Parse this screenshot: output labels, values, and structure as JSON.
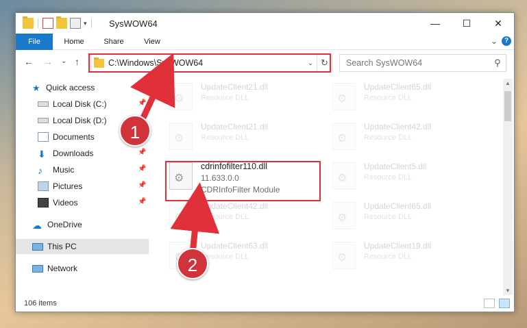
{
  "window": {
    "title": "SysWOW64",
    "controls": {
      "minimize": "—",
      "maximize": "☐",
      "close": "✕"
    }
  },
  "ribbon": {
    "tabs": [
      "File",
      "Home",
      "Share",
      "View"
    ],
    "expand_glyph": "⌄",
    "help_glyph": "?"
  },
  "nav": {
    "back": "←",
    "forward": "→",
    "recent": "⌄",
    "up": "↑",
    "address": "C:\\Windows\\SysWOW64",
    "address_dropdown": "⌄",
    "refresh": "↻",
    "search_placeholder": "Search SysWOW64",
    "search_icon": "⚲"
  },
  "sidebar": {
    "items": [
      {
        "label": "Quick access",
        "icon": "star-icon",
        "pinned": false
      },
      {
        "label": "Local Disk (C:)",
        "icon": "drive-icon",
        "pinned": true
      },
      {
        "label": "Local Disk (D:)",
        "icon": "drive-icon",
        "pinned": true
      },
      {
        "label": "Documents",
        "icon": "documents-icon",
        "pinned": true
      },
      {
        "label": "Downloads",
        "icon": "download-icon",
        "pinned": true
      },
      {
        "label": "Music",
        "icon": "music-icon",
        "pinned": true
      },
      {
        "label": "Pictures",
        "icon": "pictures-icon",
        "pinned": true
      },
      {
        "label": "Videos",
        "icon": "videos-icon",
        "pinned": true
      },
      {
        "label": "OneDrive",
        "icon": "cloud-icon",
        "pinned": false
      },
      {
        "label": "This PC",
        "icon": "computer-icon",
        "pinned": false
      },
      {
        "label": "Network",
        "icon": "network-icon",
        "pinned": false
      }
    ],
    "pin_glyph": "📌"
  },
  "files": [
    {
      "name": "UpdateClient21.dll",
      "desc": "Resource DLL"
    },
    {
      "name": "UpdateClient65.dll",
      "desc": "Resource DLL"
    },
    {
      "name": "UpdateClient21.dll",
      "desc": "Resource DLL"
    },
    {
      "name": "UpdateClient42.dll",
      "desc": "Resource DLL"
    },
    {
      "name": "UpdateClient5.dll",
      "desc": "Resource DLL"
    },
    {
      "name": "UpdateClient42.dll",
      "desc": "Resource DLL"
    },
    {
      "name": "UpdateClient65.dll",
      "desc": "Resource DLL"
    },
    {
      "name": "UpdateClient63.dll",
      "desc": "Resource DLL"
    },
    {
      "name": "UpdateClient19.dll",
      "desc": "Resource DLL"
    }
  ],
  "highlighted_file": {
    "name": "cdrinfofilter110.dll",
    "version": "11.633.0.0",
    "description": "CDRInfoFilter Module"
  },
  "status": {
    "item_count": "106 items"
  },
  "annotations": {
    "badge1": "1",
    "badge2": "2",
    "color": "#d0343a"
  },
  "colors": {
    "accent": "#1979ca",
    "annotation_red": "#e0303a"
  }
}
